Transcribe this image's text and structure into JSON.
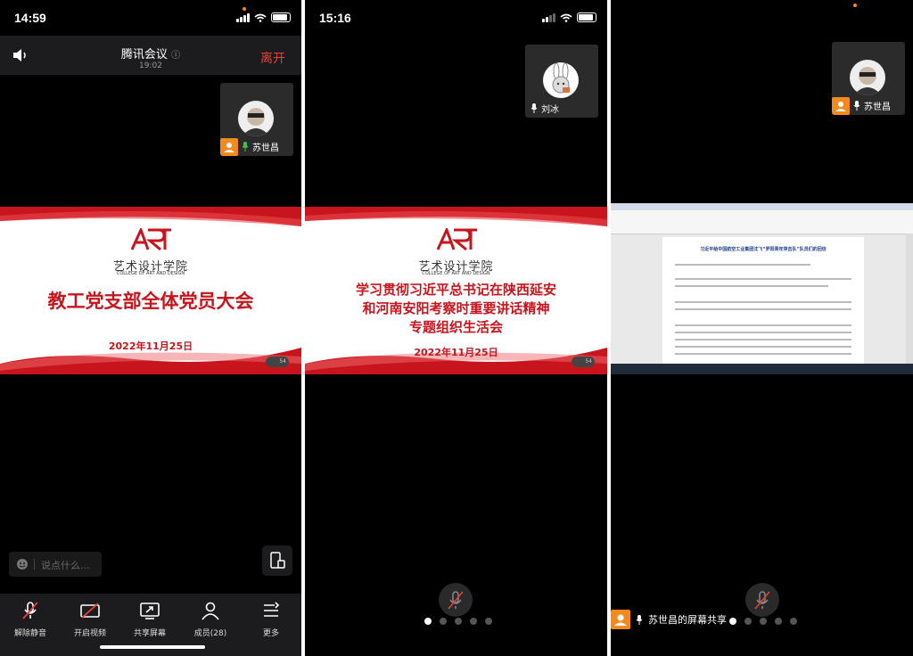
{
  "panel1": {
    "status_time": "14:59",
    "meeting_title": "腾讯会议",
    "meeting_timer": "19:02",
    "leave_label": "离开",
    "participant_name": "苏世昌",
    "slide": {
      "school": "艺术设计学院",
      "school_en": "COLLEGE OF ART AND DESIGN",
      "headline_lines": [
        "教工党支部全体党员大会"
      ],
      "date": "2022年11月25日",
      "badge": "54"
    },
    "chat_placeholder": "说点什么...",
    "toolbar": [
      {
        "label": "解除静音",
        "icon": "mic-muted-icon"
      },
      {
        "label": "开启视频",
        "icon": "video-off-icon"
      },
      {
        "label": "共享屏幕",
        "icon": "share-screen-icon"
      },
      {
        "label": "成员(28)",
        "icon": "members-icon"
      },
      {
        "label": "更多",
        "icon": "more-icon"
      }
    ]
  },
  "panel2": {
    "status_time": "15:16",
    "participant_name": "刘冰",
    "slide": {
      "school": "艺术设计学院",
      "school_en": "COLLEGE OF ART AND DESIGN",
      "headline_lines": [
        "学习贯彻习近平总书记在陕西延安",
        "和河南安阳考察时重要讲话精神",
        "专题组织生活会"
      ],
      "date": "2022年11月25日",
      "badge": "54"
    },
    "page_dots": 5,
    "active_dot": 0
  },
  "panel3": {
    "participant_name": "苏世昌",
    "doc_title": "习近平给中国航空工业集团沈飞“罗阳青年突击队”队员们的回信",
    "share_label": "苏世昌的屏幕共享",
    "page_dots": 5,
    "active_dot": 0
  },
  "colors": {
    "accent_red": "#c8141d",
    "leave_red": "#e5403a",
    "orange": "#f48a1e"
  }
}
